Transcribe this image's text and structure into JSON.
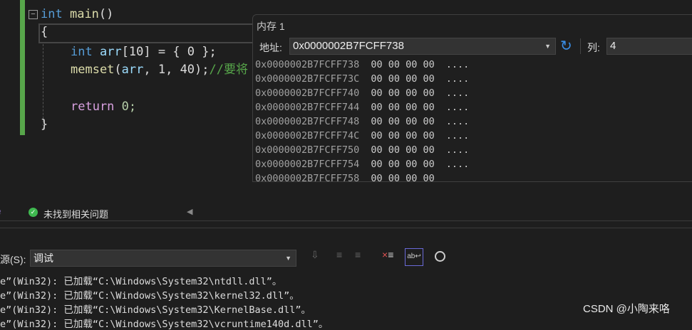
{
  "editor": {
    "lines": {
      "l1_kw": "int",
      "l1_fn": "main",
      "l1_p": "()",
      "l2": "{",
      "l3_kw": "int",
      "l3_var": "arr",
      "l3_rest": "[10] = { 0 };",
      "l4_fn": "memset",
      "l4_a": "(",
      "l4_var": "arr",
      "l4_b": ", 1, 40);",
      "l4_cm": "//要将",
      "l5_kw": "return",
      "l5_rest": " 0;",
      "l6": "}"
    }
  },
  "memory": {
    "title": "内存 1",
    "address_label": "地址:",
    "address": "0x0000002B7FCFF738",
    "columns_label": "列:",
    "columns": "4",
    "rows": [
      {
        "addr": "0x0000002B7FCFF738",
        "bytes": "00 00 00 00",
        "ascii": "...."
      },
      {
        "addr": "0x0000002B7FCFF73C",
        "bytes": "00 00 00 00",
        "ascii": "...."
      },
      {
        "addr": "0x0000002B7FCFF740",
        "bytes": "00 00 00 00",
        "ascii": "...."
      },
      {
        "addr": "0x0000002B7FCFF744",
        "bytes": "00 00 00 00",
        "ascii": "...."
      },
      {
        "addr": "0x0000002B7FCFF748",
        "bytes": "00 00 00 00",
        "ascii": "...."
      },
      {
        "addr": "0x0000002B7FCFF74C",
        "bytes": "00 00 00 00",
        "ascii": "...."
      },
      {
        "addr": "0x0000002B7FCFF750",
        "bytes": "00 00 00 00",
        "ascii": "...."
      },
      {
        "addr": "0x0000002B7FCFF754",
        "bytes": "00 00 00 00",
        "ascii": "...."
      },
      {
        "addr": "0x0000002B7FCFF758",
        "bytes": "00 00 00 00",
        "ascii": ""
      }
    ]
  },
  "status": {
    "issues": "未找到相关问题"
  },
  "output": {
    "source_label": "源(S):",
    "source": "调试",
    "lines": [
      "e”(Win32): 已加载“C:\\Windows\\System32\\ntdll.dll”。",
      "e”(Win32): 已加载“C:\\Windows\\System32\\kernel32.dll”。",
      "e”(Win32): 已加载“C:\\Windows\\System32\\KernelBase.dll”。",
      "e”(Win32): 已加载“C:\\Windows\\System32\\vcruntime140d.dll”。"
    ]
  },
  "watermark": "CSDN @小陶来咯"
}
